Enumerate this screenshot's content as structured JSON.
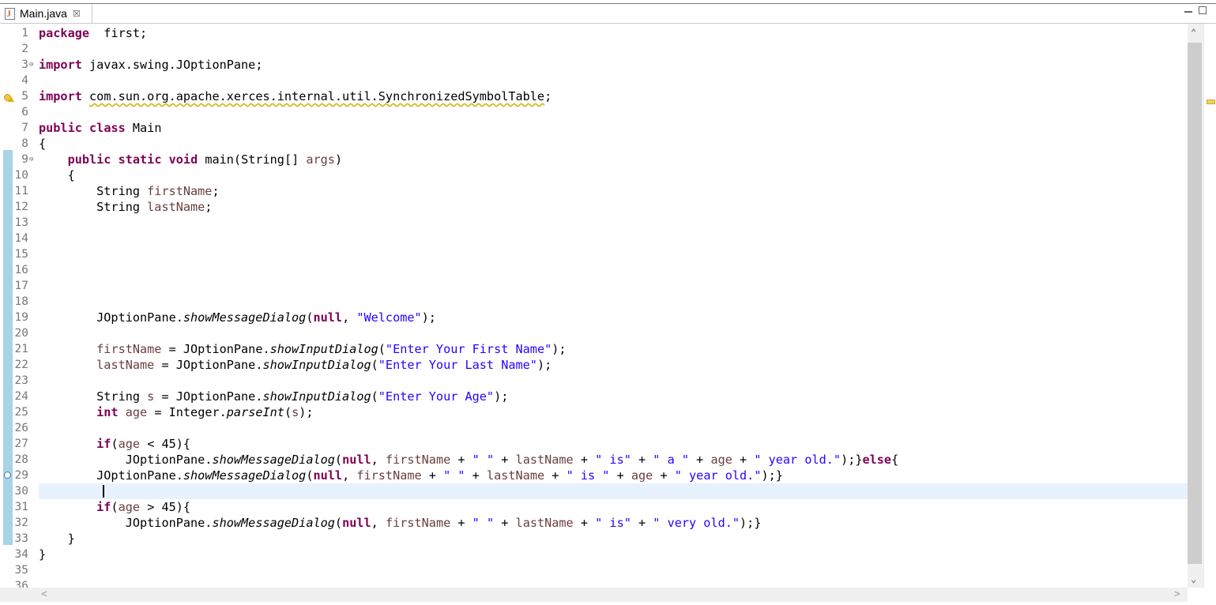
{
  "tab": {
    "title": "Main.java",
    "close": "☒"
  },
  "scroll": {
    "up": "⌃",
    "down": "⌄",
    "left": "<",
    "right": ">"
  },
  "lines": [
    {
      "n": "1",
      "tokens": [
        [
          "kw",
          "package"
        ],
        [
          "",
          "  first;"
        ]
      ]
    },
    {
      "n": "2",
      "tokens": []
    },
    {
      "n": "3",
      "fold": "⊖",
      "tokens": [
        [
          "kw",
          "import"
        ],
        [
          "",
          " javax.swing.JOptionPane;"
        ]
      ]
    },
    {
      "n": "4",
      "tokens": []
    },
    {
      "n": "5",
      "tokens": [
        [
          "kw",
          "import"
        ],
        [
          "",
          " "
        ],
        [
          "warn-u",
          "com.sun.org.apache.xerces.internal.util.SynchronizedSymbolTable"
        ],
        [
          "",
          ";"
        ]
      ]
    },
    {
      "n": "6",
      "tokens": []
    },
    {
      "n": "7",
      "tokens": [
        [
          "kw",
          "public"
        ],
        [
          "",
          " "
        ],
        [
          "kw",
          "class"
        ],
        [
          "",
          " Main"
        ]
      ]
    },
    {
      "n": "8",
      "tokens": [
        [
          "",
          "{"
        ]
      ]
    },
    {
      "n": "9",
      "fold": "⊖",
      "tokens": [
        [
          "",
          "    "
        ],
        [
          "kw",
          "public"
        ],
        [
          "",
          " "
        ],
        [
          "kw",
          "static"
        ],
        [
          "",
          " "
        ],
        [
          "kw",
          "void"
        ],
        [
          "",
          " main(String[] "
        ],
        [
          "var",
          "args"
        ],
        [
          "",
          ")"
        ]
      ]
    },
    {
      "n": "10",
      "tokens": [
        [
          "",
          "    {"
        ]
      ]
    },
    {
      "n": "11",
      "tokens": [
        [
          "",
          "        String "
        ],
        [
          "var",
          "firstName"
        ],
        [
          "",
          ";"
        ]
      ]
    },
    {
      "n": "12",
      "tokens": [
        [
          "",
          "        String "
        ],
        [
          "var",
          "lastName"
        ],
        [
          "",
          ";"
        ]
      ]
    },
    {
      "n": "13",
      "tokens": []
    },
    {
      "n": "14",
      "tokens": []
    },
    {
      "n": "15",
      "tokens": []
    },
    {
      "n": "16",
      "tokens": []
    },
    {
      "n": "17",
      "tokens": []
    },
    {
      "n": "18",
      "tokens": []
    },
    {
      "n": "19",
      "tokens": [
        [
          "",
          "        JOptionPane."
        ],
        [
          "it",
          "showMessageDialog"
        ],
        [
          "",
          "("
        ],
        [
          "kw",
          "null"
        ],
        [
          "",
          ", "
        ],
        [
          "str",
          "\"Welcome\""
        ],
        [
          "",
          ");"
        ]
      ]
    },
    {
      "n": "20",
      "tokens": []
    },
    {
      "n": "21",
      "tokens": [
        [
          "",
          "        "
        ],
        [
          "var",
          "firstName"
        ],
        [
          "",
          " = JOptionPane."
        ],
        [
          "it",
          "showInputDialog"
        ],
        [
          "",
          "("
        ],
        [
          "str",
          "\"Enter Your First Name\""
        ],
        [
          "",
          ");"
        ]
      ]
    },
    {
      "n": "22",
      "tokens": [
        [
          "",
          "        "
        ],
        [
          "var",
          "lastName"
        ],
        [
          "",
          " = JOptionPane."
        ],
        [
          "it",
          "showInputDialog"
        ],
        [
          "",
          "("
        ],
        [
          "str",
          "\"Enter Your Last Name\""
        ],
        [
          "",
          ");"
        ]
      ]
    },
    {
      "n": "23",
      "tokens": []
    },
    {
      "n": "24",
      "tokens": [
        [
          "",
          "        String "
        ],
        [
          "var",
          "s"
        ],
        [
          "",
          " = JOptionPane."
        ],
        [
          "it",
          "showInputDialog"
        ],
        [
          "",
          "("
        ],
        [
          "str",
          "\"Enter Your Age\""
        ],
        [
          "",
          ");"
        ]
      ]
    },
    {
      "n": "25",
      "tokens": [
        [
          "",
          "        "
        ],
        [
          "kw",
          "int"
        ],
        [
          "",
          " "
        ],
        [
          "var",
          "age"
        ],
        [
          "",
          " = Integer."
        ],
        [
          "it",
          "parseInt"
        ],
        [
          "",
          "("
        ],
        [
          "var",
          "s"
        ],
        [
          "",
          ");"
        ]
      ]
    },
    {
      "n": "26",
      "tokens": []
    },
    {
      "n": "27",
      "tokens": [
        [
          "",
          "        "
        ],
        [
          "kw",
          "if"
        ],
        [
          "",
          "("
        ],
        [
          "var",
          "age"
        ],
        [
          "",
          " < 45){"
        ]
      ]
    },
    {
      "n": "28",
      "tokens": [
        [
          "",
          "            JOptionPane."
        ],
        [
          "it",
          "showMessageDialog"
        ],
        [
          "",
          "("
        ],
        [
          "kw",
          "null"
        ],
        [
          "",
          ", "
        ],
        [
          "var",
          "firstName"
        ],
        [
          "",
          " + "
        ],
        [
          "str",
          "\" \""
        ],
        [
          "",
          " + "
        ],
        [
          "var",
          "lastName"
        ],
        [
          "",
          " + "
        ],
        [
          "str",
          "\" is\""
        ],
        [
          "",
          " + "
        ],
        [
          "str",
          "\" a \""
        ],
        [
          "",
          " + "
        ],
        [
          "var",
          "age"
        ],
        [
          "",
          " + "
        ],
        [
          "str",
          "\" year old.\""
        ],
        [
          "",
          ");}"
        ],
        [
          "kw",
          "else"
        ],
        [
          "",
          "{"
        ]
      ]
    },
    {
      "n": "29",
      "tokens": [
        [
          "",
          "        JOptionPane."
        ],
        [
          "it",
          "showMessageDialog"
        ],
        [
          "",
          "("
        ],
        [
          "kw",
          "null"
        ],
        [
          "",
          ", "
        ],
        [
          "var",
          "firstName"
        ],
        [
          "",
          " + "
        ],
        [
          "str",
          "\" \""
        ],
        [
          "",
          " + "
        ],
        [
          "var",
          "lastName"
        ],
        [
          "",
          " + "
        ],
        [
          "str",
          "\" is \""
        ],
        [
          "",
          " + "
        ],
        [
          "var",
          "age"
        ],
        [
          "",
          " + "
        ],
        [
          "str",
          "\" year old.\""
        ],
        [
          "",
          ");}"
        ]
      ]
    },
    {
      "n": "30",
      "current": true,
      "tokens": []
    },
    {
      "n": "31",
      "tokens": [
        [
          "",
          "        "
        ],
        [
          "kw",
          "if"
        ],
        [
          "",
          "("
        ],
        [
          "var",
          "age"
        ],
        [
          "",
          " > 45){"
        ]
      ]
    },
    {
      "n": "32",
      "tokens": [
        [
          "",
          "            JOptionPane."
        ],
        [
          "it",
          "showMessageDialog"
        ],
        [
          "",
          "("
        ],
        [
          "kw",
          "null"
        ],
        [
          "",
          ", "
        ],
        [
          "var",
          "firstName"
        ],
        [
          "",
          " + "
        ],
        [
          "str",
          "\" \""
        ],
        [
          "",
          " + "
        ],
        [
          "var",
          "lastName"
        ],
        [
          "",
          " + "
        ],
        [
          "str",
          "\" is\""
        ],
        [
          "",
          " + "
        ],
        [
          "str",
          "\" very old.\""
        ],
        [
          "",
          ");}"
        ]
      ]
    },
    {
      "n": "33",
      "tokens": [
        [
          "",
          "    }"
        ]
      ]
    },
    {
      "n": "34",
      "tokens": [
        [
          "",
          "}"
        ]
      ]
    },
    {
      "n": "35",
      "tokens": []
    },
    {
      "n": "36",
      "tokens": []
    }
  ]
}
